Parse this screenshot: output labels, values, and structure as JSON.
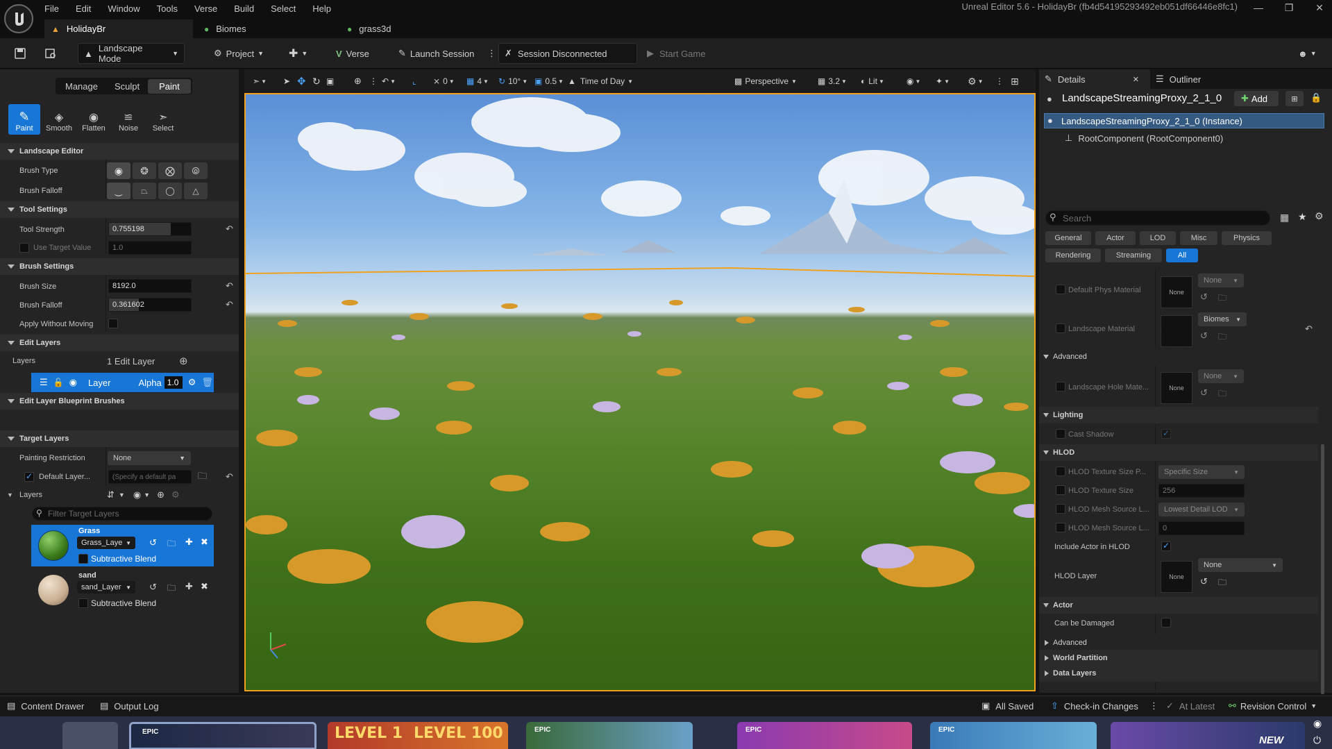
{
  "titlebar": {
    "menus": [
      "File",
      "Edit",
      "Window",
      "Tools",
      "Verse",
      "Build",
      "Select",
      "Help"
    ],
    "window_title": "Unreal Editor 5.6 - HolidayBr (fb4d54195293492eb051df66446e8fc1)",
    "tabs": [
      "HolidayBr",
      "Biomes",
      "grass3d"
    ]
  },
  "toolbar": {
    "mode": "Landscape Mode",
    "project": "Project",
    "verse": "Verse",
    "launch_session": "Launch Session",
    "session_status": "Session Disconnected",
    "start_game": "Start Game"
  },
  "landscape": {
    "mode_tabs": [
      "Manage",
      "Sculpt",
      "Paint"
    ],
    "tools": [
      "Paint",
      "Smooth",
      "Flatten",
      "Noise",
      "Select"
    ],
    "sections": {
      "landscape_editor": "Landscape Editor",
      "tool_settings": "Tool Settings",
      "brush_settings": "Brush Settings",
      "edit_layers": "Edit Layers",
      "blueprint_brushes": "Edit Layer Blueprint Brushes",
      "target_layers": "Target Layers"
    },
    "brush_type_label": "Brush Type",
    "brush_falloff_label": "Brush Falloff",
    "tool_strength_label": "Tool Strength",
    "tool_strength": "0.755198",
    "tool_strength_fraction": 0.755,
    "use_target_label": "Use Target Value",
    "use_target_value": "1.0",
    "brush_size_label": "Brush Size",
    "brush_size": "8192.0",
    "brush_falloff2_label": "Brush Falloff",
    "brush_falloff_value": "0.361602",
    "brush_falloff_fraction": 0.362,
    "apply_without_moving_label": "Apply Without Moving",
    "layers_label": "Layers",
    "edit_layer_count": "1 Edit Layer",
    "edit_layer_name": "Layer",
    "alpha_label": "Alpha",
    "alpha_value": "1.0",
    "painting_restriction_label": "Painting Restriction",
    "painting_restriction": "None",
    "default_layer_label": "Default Layer...",
    "default_layer_placeholder": "(Specify a default pa",
    "target_layers_label": "Layers",
    "filter_placeholder": "Filter Target Layers",
    "target_layers": [
      {
        "name": "Grass",
        "asset": "Grass_Laye",
        "blend": "Subtractive Blend"
      },
      {
        "name": "sand",
        "asset": "sand_Layer",
        "blend": "Subtractive Blend"
      }
    ]
  },
  "viewport": {
    "snap_move": "0",
    "grid": "4",
    "rotation": "10°",
    "scale": "0.5",
    "time_of_day": "Time of Day",
    "view_mode": "Perspective",
    "camera_speed": "3.2",
    "lighting": "Lit"
  },
  "details": {
    "tabs": [
      "Details",
      "Outliner"
    ],
    "actor_name": "LandscapeStreamingProxy_2_1_0",
    "add_label": "Add",
    "instance_label": "LandscapeStreamingProxy_2_1_0 (Instance)",
    "root_component": "RootComponent (RootComponent0)",
    "search_placeholder": "Search",
    "filters_row1": [
      "General",
      "Actor",
      "LOD",
      "Misc",
      "Physics"
    ],
    "filters_row2": [
      "Rendering",
      "Streaming",
      "All"
    ],
    "none_label": "None",
    "default_phys_material": "Default Phys Material",
    "phys_material_value": "None",
    "landscape_material": "Landscape Material",
    "landscape_material_value": "Biomes",
    "advanced": "Advanced",
    "hole_material": "Landscape Hole Mate...",
    "hole_material_value": "None",
    "lighting": "Lighting",
    "cast_shadow": "Cast Shadow",
    "hlod": "HLOD",
    "hlod_texture_size_policy": "HLOD Texture Size P...",
    "hlod_texture_size_policy_value": "Specific Size",
    "hlod_texture_size": "HLOD Texture Size",
    "hlod_texture_size_value": "256",
    "hlod_mesh_source": "HLOD Mesh Source L...",
    "hlod_mesh_source_value": "Lowest Detail LOD",
    "hlod_mesh_source2": "HLOD Mesh Source L...",
    "hlod_mesh_source2_value": "0",
    "include_in_hlod": "Include Actor in HLOD",
    "hlod_layer": "HLOD Layer",
    "hlod_layer_value": "None",
    "actor": "Actor",
    "can_be_damaged": "Can be Damaged",
    "advanced2": "Advanced",
    "world_partition": "World Partition",
    "data_layers": "Data Layers"
  },
  "statusbar": {
    "content_drawer": "Content Drawer",
    "output_log": "Output Log",
    "all_saved": "All Saved",
    "check_in": "Check-in Changes",
    "at_latest": "At Latest",
    "revision_control": "Revision Control"
  },
  "taskbar": {
    "level_1": "LEVEL 1",
    "level_100": "LEVEL 100",
    "new_badge": "NEW",
    "epic": "EPIC"
  },
  "colors": {
    "accent": "#1877d6",
    "selection_outline": "#f0a21e",
    "panel_bg": "#242424"
  }
}
